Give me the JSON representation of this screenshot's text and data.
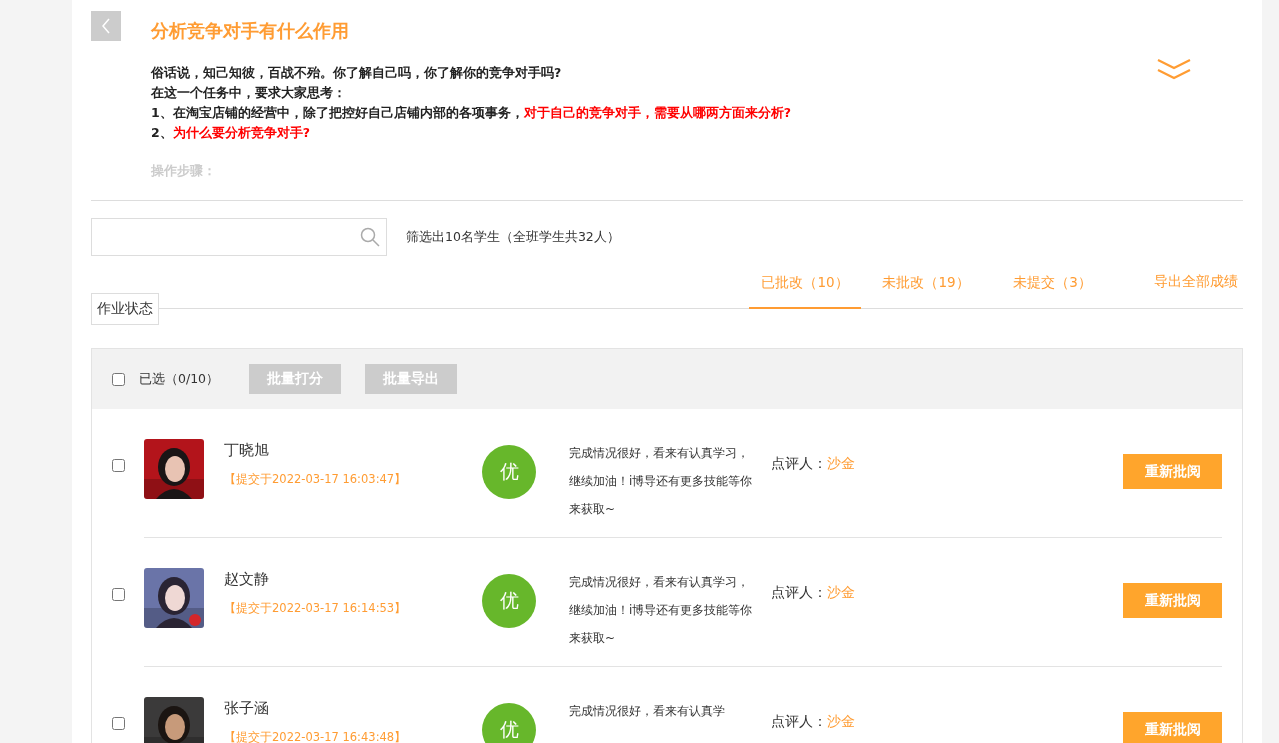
{
  "header": {
    "title": "分析竞争对手有什么作用",
    "description": [
      {
        "parts": [
          {
            "text": "俗话说，知己知彼，百战不殆。你了解自己吗，你了解你的竞争对手吗?",
            "highlight": false
          }
        ]
      },
      {
        "parts": [
          {
            "text": "在这一个任务中，要求大家思考：",
            "highlight": false
          }
        ]
      },
      {
        "parts": [
          {
            "text": "1、在淘宝店铺的经营中，除了把控好自己店铺内部的各项事务，",
            "highlight": false
          },
          {
            "text": "对于自己的竞争对手，需要从哪两方面来分析?",
            "highlight": true
          }
        ]
      },
      {
        "parts": [
          {
            "text": "2、",
            "highlight": false
          },
          {
            "text": "为什么要分析竞争对手?",
            "highlight": true
          }
        ]
      }
    ],
    "faded_heading": "操作步骤："
  },
  "filter": {
    "summary": "筛选出10名学生（全班学生共32人）"
  },
  "status_label": "作业状态",
  "tabs": [
    {
      "label": "已批改（10）",
      "selected": true
    },
    {
      "label": "未批改（19）",
      "selected": false
    },
    {
      "label": "未提交（3）",
      "selected": false
    }
  ],
  "export_link": "导出全部成绩",
  "batch": {
    "select_all": {
      "checked": false,
      "label": "已选（0/10）"
    },
    "buttons": [
      "批量打分",
      "批量导出"
    ]
  },
  "submissions": [
    {
      "checked": false,
      "name": "丁晓旭",
      "submitted": "【提交于2022-03-17 16:03:47】",
      "grade": "优",
      "comment": "完成情况很好，看来有认真学习，继续加油！i博导还有更多技能等你来获取~",
      "reviewer_label": "点评人：",
      "reviewer": "沙金",
      "action": "重新批阅"
    },
    {
      "checked": false,
      "name": "赵文静",
      "submitted": "【提交于2022-03-17 16:14:53】",
      "grade": "优",
      "comment": "完成情况很好，看来有认真学习，继续加油！i博导还有更多技能等你来获取~",
      "reviewer_label": "点评人：",
      "reviewer": "沙金",
      "action": "重新批阅"
    },
    {
      "checked": false,
      "name": "张子涵",
      "submitted": "【提交于2022-03-17 16:43:48】",
      "grade": "优",
      "comment": "完成情况很好，看来有认真学",
      "reviewer_label": "点评人：",
      "reviewer": "沙金",
      "action": "重新批阅"
    }
  ]
}
